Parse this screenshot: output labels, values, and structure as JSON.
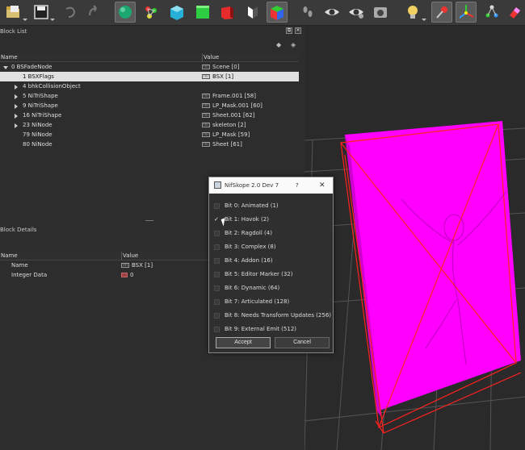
{
  "block_list": {
    "title": "Block List",
    "header": {
      "name": "Name",
      "value": "Value"
    },
    "rows": [
      {
        "name": "0 BSFadeNode",
        "value": "Scene [0]",
        "expand": "down",
        "indent": 1,
        "selected": false
      },
      {
        "name": "1 BSXFlags",
        "value": "BSX [1]",
        "expand": "none",
        "indent": 2,
        "selected": true
      },
      {
        "name": "4 bhkCollisionObject",
        "value": "",
        "expand": "right",
        "indent": 2,
        "selected": false
      },
      {
        "name": "5 NiTriShape",
        "value": "Frame.001 [58]",
        "expand": "right",
        "indent": 2,
        "selected": false
      },
      {
        "name": "9 NiTriShape",
        "value": "LP_Mask.001 [60]",
        "expand": "right",
        "indent": 2,
        "selected": false
      },
      {
        "name": "16 NiTriShape",
        "value": "Sheet.001 [62]",
        "expand": "right",
        "indent": 2,
        "selected": false
      },
      {
        "name": "23 NiNode",
        "value": "skeleton [2]",
        "expand": "right",
        "indent": 2,
        "selected": false
      },
      {
        "name": "79 NiNode",
        "value": "LP_Mask [59]",
        "expand": "none",
        "indent": 2,
        "selected": false
      },
      {
        "name": "80 NiNode",
        "value": "Sheet [61]",
        "expand": "none",
        "indent": 2,
        "selected": false
      }
    ]
  },
  "block_details": {
    "title": "Block Details",
    "header": {
      "name": "Name",
      "value": "Value"
    },
    "rows": [
      {
        "name": "Name",
        "value": "BSX [1]"
      },
      {
        "name": "Integer Data",
        "value": "0"
      }
    ]
  },
  "dialog": {
    "title": "NifSkope 2.0 Dev 7",
    "help": "?",
    "close": "✕",
    "bits": [
      {
        "label": "Bit 0: Animated (1)",
        "checked": false
      },
      {
        "label": "Bit 1: Havok (2)",
        "checked": true
      },
      {
        "label": "Bit 2: Ragdoll (4)",
        "checked": false
      },
      {
        "label": "Bit 3: Complex (8)",
        "checked": false
      },
      {
        "label": "Bit 4: Addon (16)",
        "checked": false
      },
      {
        "label": "Bit 5: Editor Marker (32)",
        "checked": false
      },
      {
        "label": "Bit 6: Dynamic (64)",
        "checked": false
      },
      {
        "label": "Bit 7: Articulated (128)",
        "checked": false
      },
      {
        "label": "Bit 8: Needs Transform Updates (256)",
        "checked": false
      },
      {
        "label": "Bit 9: External Emit (512)",
        "checked": false
      }
    ],
    "accept_label": "Accept",
    "cancel_label": "Cancel"
  },
  "toolbar_icons": [
    "open-file-icon",
    "save-icon",
    "undo-icon",
    "redo-icon",
    "sphere-icon",
    "nodes-icon",
    "cube-cyan-icon",
    "cube-green-icon",
    "cube-red-icon",
    "half-cube-icon",
    "rgb-cube-icon",
    "footprints-icon",
    "eye-icon",
    "eye-settings-icon",
    "camera-settings-icon",
    "lightbulb-icon",
    "pin-icon",
    "axes-icon",
    "node-tree-icon",
    "eraser-icon"
  ],
  "colors": {
    "accent": "#ff00ff",
    "wire": "#ff2020"
  }
}
